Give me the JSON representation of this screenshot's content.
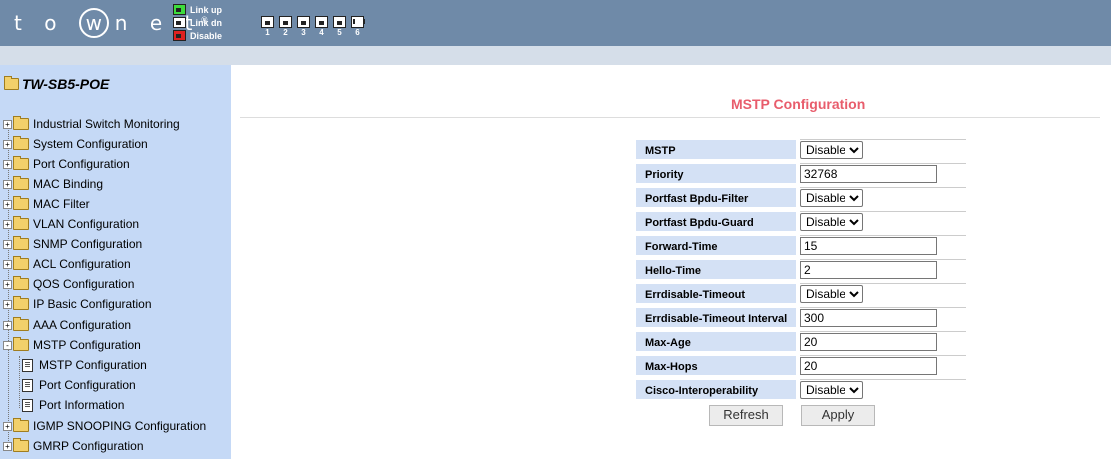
{
  "header": {
    "logo_text": "towne t",
    "logo": {
      "pre": "t o",
      "w": "w",
      "post": "n e t",
      "mark": "®"
    },
    "legend": [
      {
        "label": "Link up",
        "color": "#3ddc3d"
      },
      {
        "label": "Link dn",
        "color": "#ffffff"
      },
      {
        "label": "Disable",
        "color": "#e02020"
      }
    ],
    "ports": [
      "1",
      "2",
      "3",
      "4",
      "5",
      "6"
    ]
  },
  "sidebar": {
    "root": "TW-SB5-POE",
    "items": [
      {
        "label": "Industrial Switch Monitoring",
        "expander": "+"
      },
      {
        "label": "System Configuration",
        "expander": "+"
      },
      {
        "label": "Port Configuration",
        "expander": "+"
      },
      {
        "label": "MAC Binding",
        "expander": "+"
      },
      {
        "label": "MAC Filter",
        "expander": "+"
      },
      {
        "label": "VLAN Configuration",
        "expander": "+"
      },
      {
        "label": "SNMP Configuration",
        "expander": "+"
      },
      {
        "label": "ACL Configuration",
        "expander": "+"
      },
      {
        "label": "QOS Configuration",
        "expander": "+"
      },
      {
        "label": "IP Basic Configuration",
        "expander": "+"
      },
      {
        "label": "AAA Configuration",
        "expander": "+"
      },
      {
        "label": "MSTP Configuration",
        "expander": "-"
      },
      {
        "label": "IGMP SNOOPING Configuration",
        "expander": "+"
      },
      {
        "label": "GMRP Configuration",
        "expander": "+"
      }
    ],
    "subitems": [
      "MSTP Configuration",
      "Port Configuration",
      "Port Information"
    ]
  },
  "main": {
    "title": "MSTP Configuration",
    "rows": [
      {
        "label": "MSTP",
        "type": "select",
        "value": "Disable"
      },
      {
        "label": "Priority",
        "type": "input",
        "value": "32768"
      },
      {
        "label": "Portfast Bpdu-Filter",
        "type": "select",
        "value": "Disable"
      },
      {
        "label": "Portfast Bpdu-Guard",
        "type": "select",
        "value": "Disable"
      },
      {
        "label": "Forward-Time",
        "type": "input",
        "value": "15"
      },
      {
        "label": "Hello-Time",
        "type": "input",
        "value": "2"
      },
      {
        "label": "Errdisable-Timeout",
        "type": "select",
        "value": "Disable"
      },
      {
        "label": "Errdisable-Timeout Interval",
        "type": "input",
        "value": "300"
      },
      {
        "label": "Max-Age",
        "type": "input",
        "value": "20"
      },
      {
        "label": "Max-Hops",
        "type": "input",
        "value": "20"
      },
      {
        "label": "Cisco-Interoperability",
        "type": "select",
        "value": "Disable"
      }
    ],
    "buttons": {
      "refresh": "Refresh",
      "apply": "Apply"
    }
  }
}
